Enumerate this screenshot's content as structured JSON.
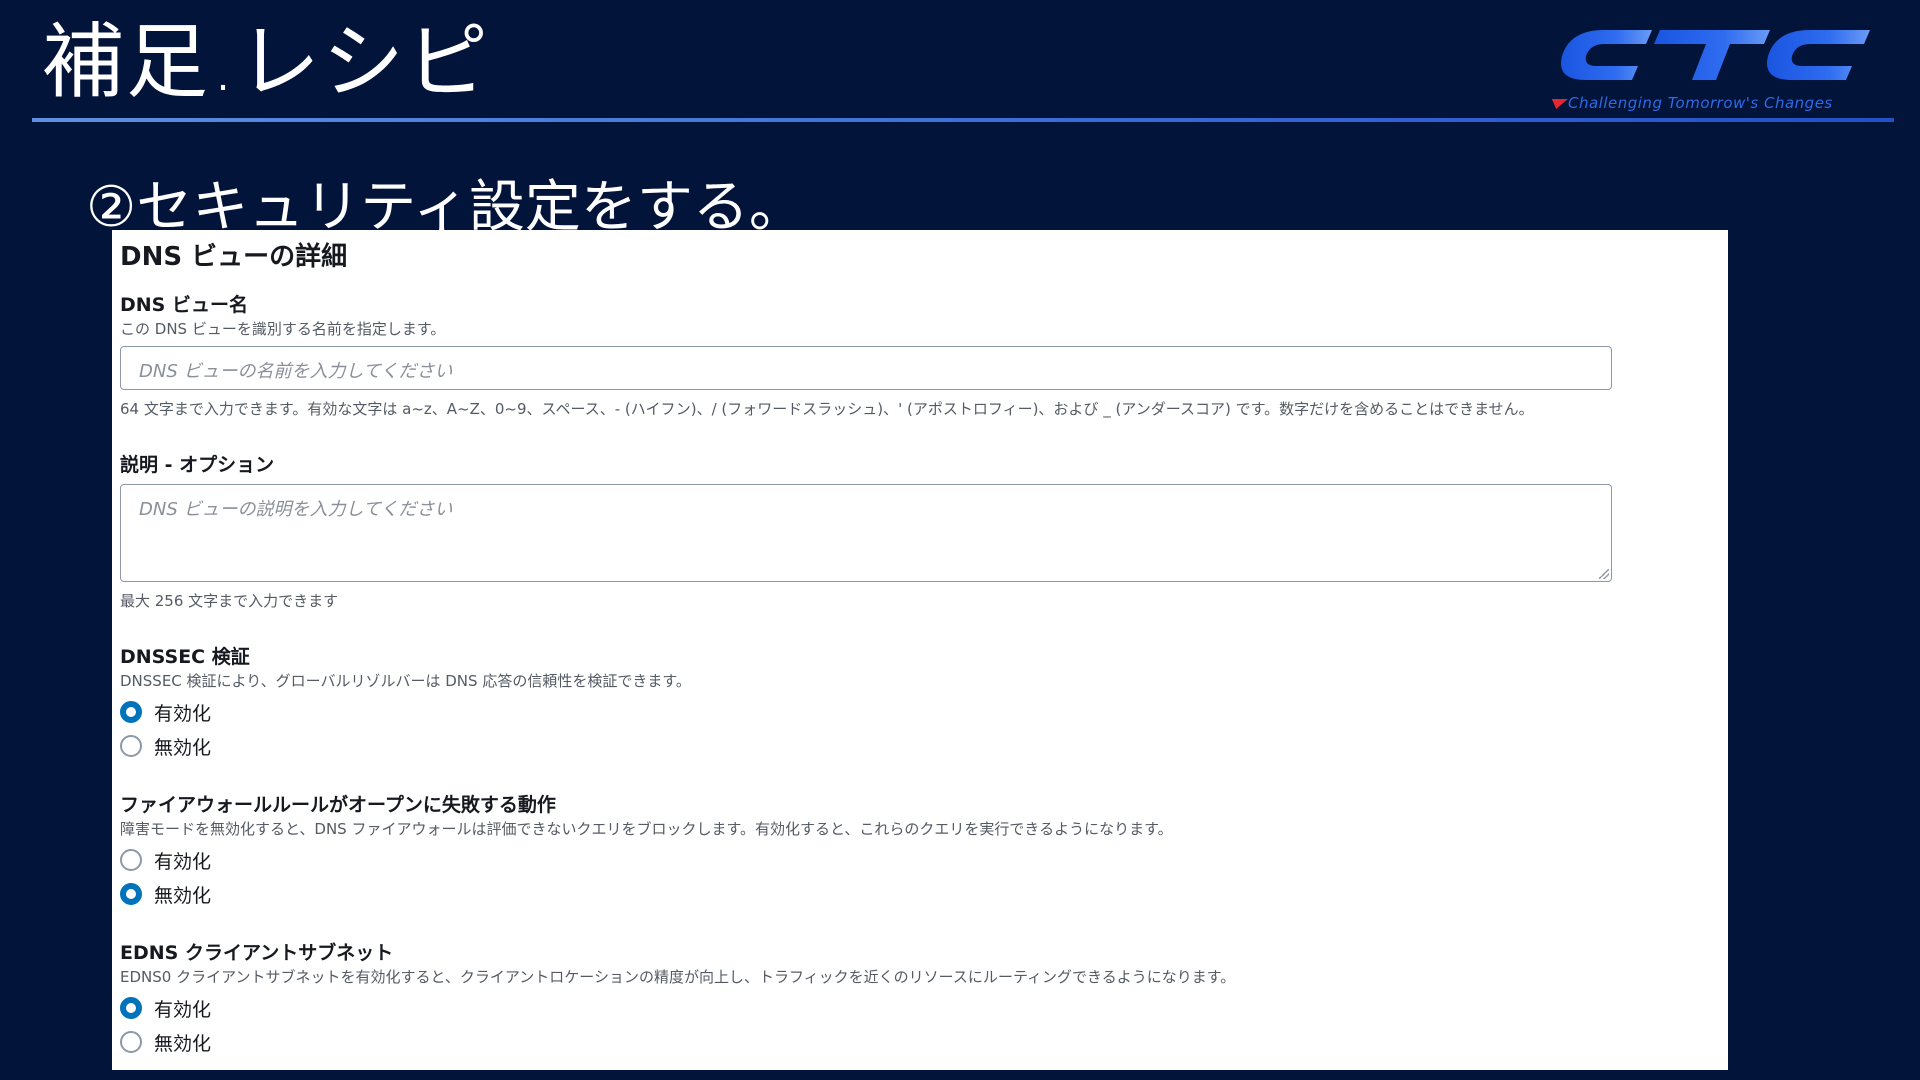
{
  "slide": {
    "title": "補足.レシピ",
    "step_heading": "②セキュリティ設定をする。"
  },
  "logo": {
    "wordmark": "CTC",
    "tagline": "Challenging Tomorrow's Changes",
    "colors": {
      "primary": "#1e5ee6",
      "accent": "#e3262f"
    }
  },
  "panel": {
    "title": "DNS ビューの詳細",
    "name_field": {
      "label": "DNS ビュー名",
      "description": "この DNS ビューを識別する名前を指定します。",
      "placeholder": "DNS ビューの名前を入力してください",
      "value": "",
      "hint": "64 文字まで入力できます。有効な文字は a~z、A~Z、0~9、スペース、- (ハイフン)、/ (フォワードスラッシュ)、' (アポストロフィー)、および _ (アンダースコア) です。数字だけを含めることはできません。"
    },
    "description_field": {
      "label": "説明 - オプション",
      "placeholder": "DNS ビューの説明を入力してください",
      "value": "",
      "hint": "最大 256 文字まで入力できます"
    },
    "dnssec": {
      "label": "DNSSEC 検証",
      "description": "DNSSEC 検証により、グローバルリゾルバーは DNS 応答の信頼性を検証できます。",
      "options": [
        "有効化",
        "無効化"
      ],
      "selected": "有効化"
    },
    "firewall_fail_open": {
      "label": "ファイアウォールルールがオープンに失敗する動作",
      "description": "障害モードを無効化すると、DNS ファイアウォールは評価できないクエリをブロックします。有効化すると、これらのクエリを実行できるようになります。",
      "options": [
        "有効化",
        "無効化"
      ],
      "selected": "無効化"
    },
    "edns_client_subnet": {
      "label": "EDNS クライアントサブネット",
      "description": "EDNS0 クライアントサブネットを有効化すると、クライアントロケーションの精度が向上し、トラフィックを近くのリソースにルーティングできるようになります。",
      "options": [
        "有効化",
        "無効化"
      ],
      "selected": "有効化"
    },
    "colors": {
      "radio_checked": "#0073bb",
      "text": "#16191f",
      "muted": "#545b64"
    }
  }
}
